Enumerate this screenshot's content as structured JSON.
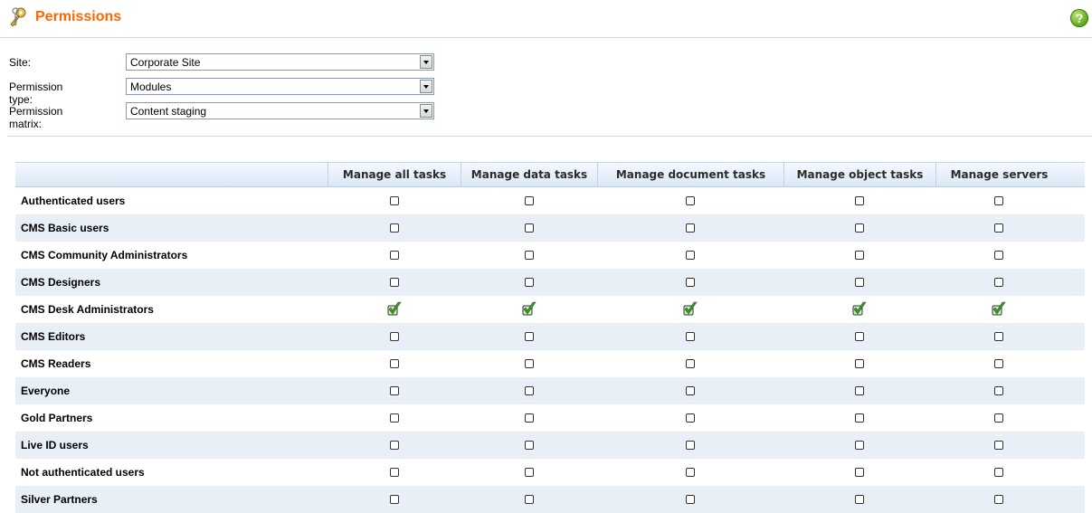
{
  "header": {
    "title": "Permissions",
    "title_icon": "keys-icon",
    "help_icon": "help-icon",
    "title_color": "#ff6600"
  },
  "form": {
    "site": {
      "label": "Site:",
      "value": "Corporate Site"
    },
    "permission_type": {
      "label": "Permission type:",
      "value": "Modules"
    },
    "permission_matrix": {
      "label": "Permission matrix:",
      "value": "Content staging"
    }
  },
  "matrix": {
    "columns": [
      "Manage all tasks",
      "Manage data tasks",
      "Manage document tasks",
      "Manage object tasks",
      "Manage servers"
    ],
    "rows": [
      {
        "label": "Authenticated users",
        "checked": [
          false,
          false,
          false,
          false,
          false
        ]
      },
      {
        "label": "CMS Basic users",
        "checked": [
          false,
          false,
          false,
          false,
          false
        ]
      },
      {
        "label": "CMS Community Administrators",
        "checked": [
          false,
          false,
          false,
          false,
          false
        ]
      },
      {
        "label": "CMS Designers",
        "checked": [
          false,
          false,
          false,
          false,
          false
        ]
      },
      {
        "label": "CMS Desk Administrators",
        "checked": [
          true,
          true,
          true,
          true,
          true
        ]
      },
      {
        "label": "CMS Editors",
        "checked": [
          false,
          false,
          false,
          false,
          false
        ]
      },
      {
        "label": "CMS Readers",
        "checked": [
          false,
          false,
          false,
          false,
          false
        ]
      },
      {
        "label": "Everyone",
        "checked": [
          false,
          false,
          false,
          false,
          false
        ]
      },
      {
        "label": "Gold Partners",
        "checked": [
          false,
          false,
          false,
          false,
          false
        ]
      },
      {
        "label": "Live ID users",
        "checked": [
          false,
          false,
          false,
          false,
          false
        ]
      },
      {
        "label": "Not authenticated users",
        "checked": [
          false,
          false,
          false,
          false,
          false
        ]
      },
      {
        "label": "Silver Partners",
        "checked": [
          false,
          false,
          false,
          false,
          false
        ]
      }
    ]
  },
  "colors": {
    "header_gradient_top": "#f4f9ff",
    "header_gradient_bottom": "#dbe8f6",
    "alt_row": "#e8eff7",
    "check_green": "#3e9a2a"
  }
}
